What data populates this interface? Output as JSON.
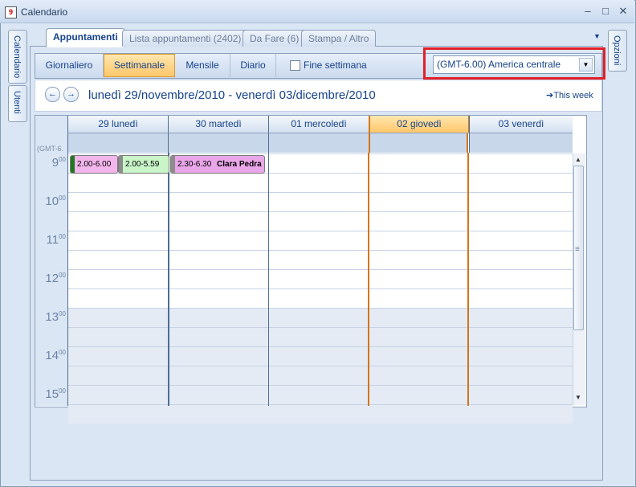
{
  "window": {
    "title": "Calendario",
    "icon_day": "9",
    "controls": [
      "minimize-icon",
      "maximize-icon",
      "close-icon"
    ]
  },
  "side_tabs": {
    "left": [
      "Calendario",
      "Utenti"
    ],
    "right": [
      "Opzioni"
    ]
  },
  "tabs": [
    {
      "label": "Appuntamenti",
      "active": true
    },
    {
      "label": "Lista appuntamenti (2402)",
      "active": false
    },
    {
      "label": "Da Fare (6)",
      "active": false
    },
    {
      "label": "Stampa / Altro",
      "active": false
    }
  ],
  "views": [
    {
      "label": "Giornaliero",
      "active": false
    },
    {
      "label": "Settimanale",
      "active": true
    },
    {
      "label": "Mensile",
      "active": false
    },
    {
      "label": "Diario",
      "active": false
    }
  ],
  "weekend_label": "Fine settimana",
  "weekend_checked": false,
  "timezone": {
    "selected": "(GMT-6.00) America centrale"
  },
  "date_range": "lunedì 29/novembre/2010 - venerdì 03/dicembre/2010",
  "this_week_label": "This week",
  "gmt_label": "(GMT-6.",
  "days": [
    {
      "label": "29 lunedì",
      "today": false
    },
    {
      "label": "30 martedì",
      "today": false
    },
    {
      "label": "01 mercoledì",
      "today": false
    },
    {
      "label": "02 giovedì",
      "today": true
    },
    {
      "label": "03 venerdì",
      "today": false
    }
  ],
  "hours": [
    {
      "h": "9",
      "m": "00"
    },
    {
      "h": "10",
      "m": "00"
    },
    {
      "h": "11",
      "m": "00"
    },
    {
      "h": "12",
      "m": "00"
    },
    {
      "h": "13",
      "m": "00"
    },
    {
      "h": "14",
      "m": "00"
    },
    {
      "h": "15",
      "m": "00"
    }
  ],
  "appointments": [
    {
      "text": "2.00-6.00",
      "color": "#f3b6ec",
      "bar": "#1f7a1f"
    },
    {
      "text": "2.00-5.59",
      "color": "#c9f5c9",
      "bar": "#8c8c8c"
    },
    {
      "text": "2.30-6.30",
      "name": "Clara Pedra",
      "color": "#e9a6e8",
      "bar": "#8c8c8c"
    }
  ],
  "colors": {
    "accent": "#15428b",
    "today": "#ffc76a",
    "highlight": "#e32029"
  }
}
